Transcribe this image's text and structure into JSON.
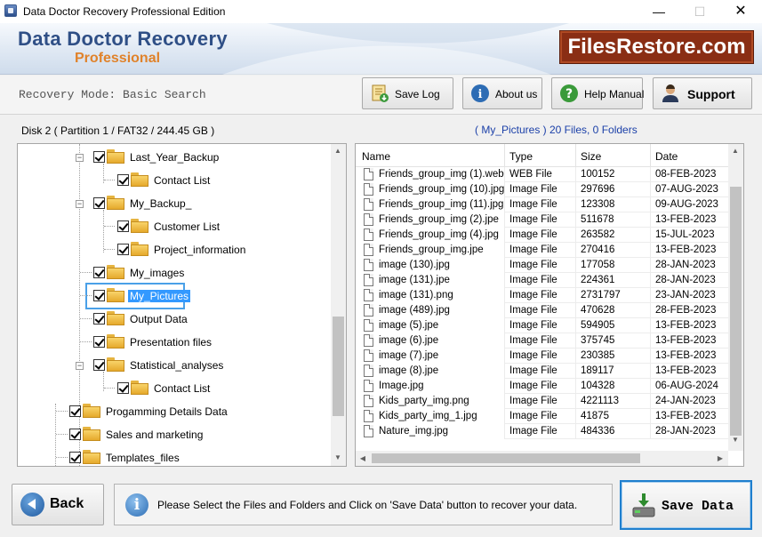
{
  "window": {
    "title": "Data Doctor Recovery Professional Edition",
    "min": "—",
    "max": "☐",
    "close": "✕"
  },
  "banner": {
    "brand_main": "Data Doctor Recovery",
    "brand_sub": "Professional",
    "site": "FilesRestore.com"
  },
  "toolbar": {
    "mode": "Recovery Mode: Basic Search",
    "save_log": "Save Log",
    "about": "About us",
    "help": "Help Manual",
    "support": "Support"
  },
  "info": {
    "disk": "Disk 2 ( Partition 1 / FAT32 / 244.45 GB )",
    "current_folder": "( My_Pictures )",
    "counts": "20 Files, 0 Folders"
  },
  "tree": [
    {
      "label": "Last_Year_Backup"
    },
    {
      "label": "Contact List"
    },
    {
      "label": "My_Backup_"
    },
    {
      "label": "Customer List"
    },
    {
      "label": "Project_information"
    },
    {
      "label": "My_images"
    },
    {
      "label": "My_Pictures"
    },
    {
      "label": "Output Data"
    },
    {
      "label": "Presentation files"
    },
    {
      "label": "Statistical_analyses"
    },
    {
      "label": "Contact List"
    },
    {
      "label": "Progamming Details Data"
    },
    {
      "label": "Sales and marketing"
    },
    {
      "label": "Templates_files"
    }
  ],
  "files": {
    "columns": [
      "Name",
      "Type",
      "Size",
      "Date"
    ],
    "rows": [
      [
        "Friends_group_img (1).web",
        "WEB File",
        "100152",
        "08-FEB-2023"
      ],
      [
        "Friends_group_img (10).jpg",
        "Image File",
        "297696",
        "07-AUG-2023"
      ],
      [
        "Friends_group_img (11).jpg",
        "Image File",
        "123308",
        "09-AUG-2023"
      ],
      [
        "Friends_group_img (2).jpe",
        "Image File",
        "511678",
        "13-FEB-2023"
      ],
      [
        "Friends_group_img (4).jpg",
        "Image File",
        "263582",
        "15-JUL-2023"
      ],
      [
        "Friends_group_img.jpe",
        "Image File",
        "270416",
        "13-FEB-2023"
      ],
      [
        "image (130).jpg",
        "Image File",
        "177058",
        "28-JAN-2023"
      ],
      [
        "image (131).jpe",
        "Image File",
        "224361",
        "28-JAN-2023"
      ],
      [
        "image (131).png",
        "Image File",
        "2731797",
        "23-JAN-2023"
      ],
      [
        "image (489).jpg",
        "Image File",
        "470628",
        "28-FEB-2023"
      ],
      [
        "image (5).jpe",
        "Image File",
        "594905",
        "13-FEB-2023"
      ],
      [
        "image (6).jpe",
        "Image File",
        "375745",
        "13-FEB-2023"
      ],
      [
        "image (7).jpe",
        "Image File",
        "230385",
        "13-FEB-2023"
      ],
      [
        "image (8).jpe",
        "Image File",
        "189117",
        "13-FEB-2023"
      ],
      [
        "Image.jpg",
        "Image File",
        "104328",
        "06-AUG-2024"
      ],
      [
        "Kids_party_img.png",
        "Image File",
        "4221113",
        "24-JAN-2023"
      ],
      [
        "Kids_party_img_1.jpg",
        "Image File",
        "41875",
        "13-FEB-2023"
      ],
      [
        "Nature_img.jpg",
        "Image File",
        "484336",
        "28-JAN-2023"
      ]
    ]
  },
  "bottom": {
    "back": "Back",
    "message": "Please Select the Files and Folders and Click on 'Save Data' button to recover your data.",
    "save": "Save Data"
  },
  "colors": {
    "brand_blue": "#2f4f86",
    "brand_orange": "#e0822a",
    "site_badge": "#8a2e14",
    "selection": "#3399ff",
    "info_blue": "#1a3fa8"
  }
}
